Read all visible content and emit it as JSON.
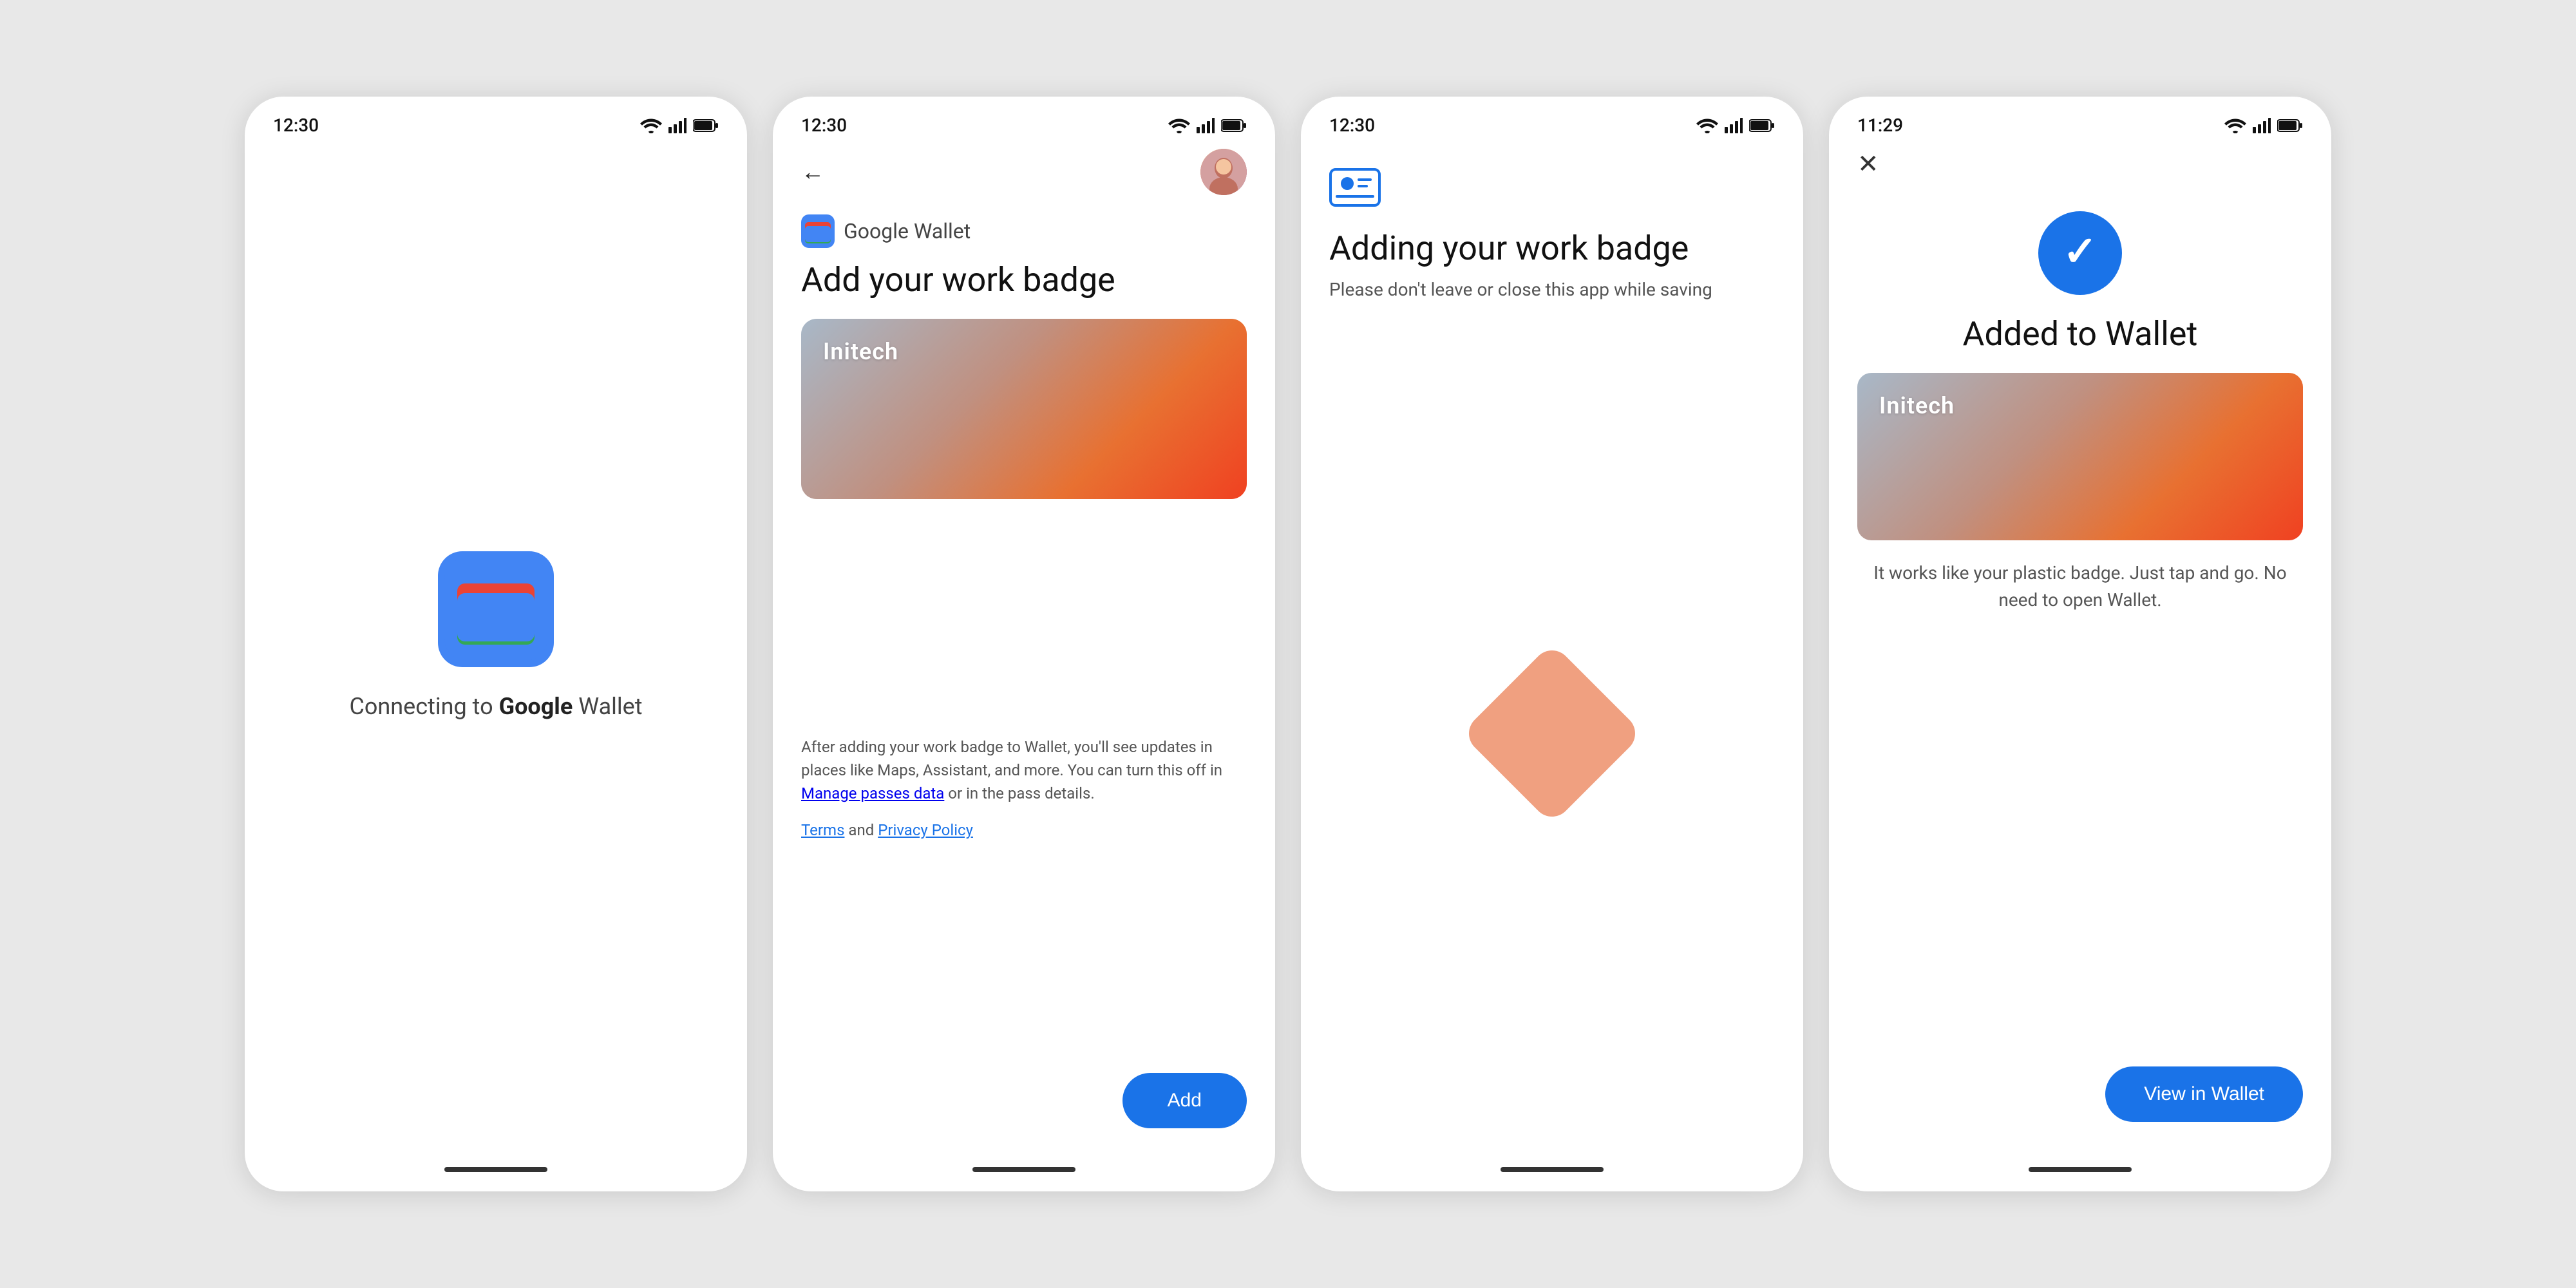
{
  "screens": [
    {
      "id": "screen1",
      "statusBar": {
        "time": "12:30"
      },
      "connectingText1": "Connecting to ",
      "connectingTextBold": "Google",
      "connectingText2": " Wallet"
    },
    {
      "id": "screen2",
      "statusBar": {
        "time": "12:30"
      },
      "googleWalletLabel": "Google Wallet",
      "addBadgeTitle": "Add your work badge",
      "companyName": "Initech",
      "descriptionText": "After adding your work badge to Wallet, you'll see updates in places like Maps, Assistant, and more. You can turn this off in",
      "managePassesLink": "Manage passes data",
      "descriptionText2": " or in the pass details.",
      "termsLink": "Terms",
      "andText": " and ",
      "privacyLink": "Privacy Policy",
      "addButtonLabel": "Add"
    },
    {
      "id": "screen3",
      "statusBar": {
        "time": "12:30"
      },
      "addingTitle": "Adding your work badge",
      "addingSubtitle": "Please don't leave or close this app while saving"
    },
    {
      "id": "screen4",
      "statusBar": {
        "time": "11:29"
      },
      "addedTitle": "Added to Wallet",
      "companyName": "Initech",
      "addedDesc": "It works like your plastic badge. Just tap and go. No need to open Wallet.",
      "viewButtonLabel": "View in Wallet"
    }
  ]
}
